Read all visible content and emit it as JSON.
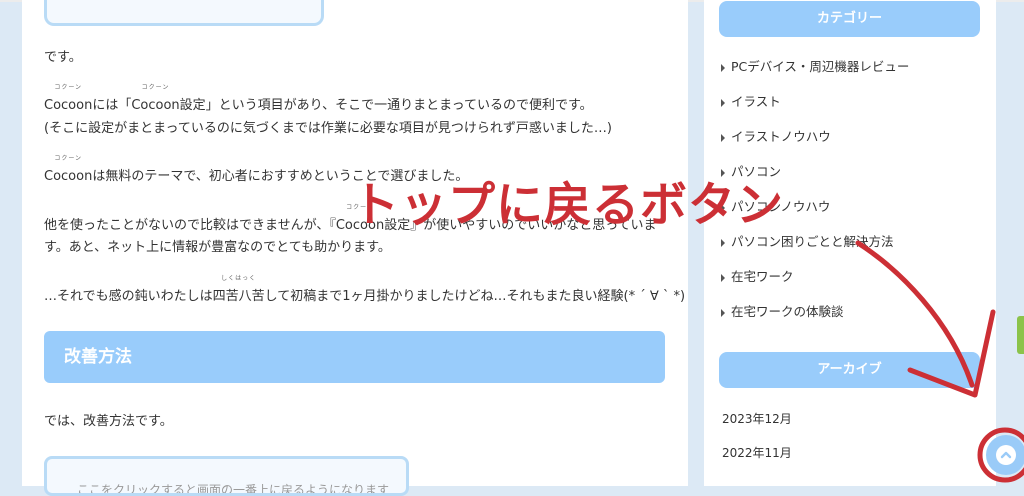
{
  "article": {
    "p1": "です。",
    "p2_ruby_text": "コクーン",
    "p2_word": "Cocoon",
    "p2_mid": "には「",
    "p2_ruby2_text": "コクーン",
    "p2_word2": "Cocoon",
    "p2_rest": "設定」という項目があり、そこで一通りまとまっているので便利です。",
    "p3": "(そこに設定がまとまっているのに気づくまでは作業に必要な項目が見つけられず戸惑いました…)",
    "p4_ruby_text": "コクーン",
    "p4_word": "Cocoon",
    "p4_rest": "は無料のテーマで、初心者におすすめということで選びました。",
    "p5_a": "他を使ったことがないので比較はできませんが、『",
    "p5_ruby_text": "コクーン",
    "p5_word": "Cocoon",
    "p5_b": "設定』が使いやすいのでいいかなと思っていま",
    "p6": "す。あと、ネット上に情報が豊富なのでとても助かります。",
    "p7_a": "…それでも感の鈍いわたしは",
    "p7_ruby_text": "しくはっく",
    "p7_word": "四苦八苦",
    "p7_b": "して初稿まで1ヶ月掛かりましたけどね…それもまた良い経験(* ´ ∀ ` *)",
    "h2": "改善方法",
    "p8": "では、改善方法です。",
    "box_text": "ここをクリックすると画面の一番上に戻るようになります"
  },
  "sidebar": {
    "categories_title": "カテゴリー",
    "categories": [
      "PCデバイス・周辺機器レビュー",
      "イラスト",
      "イラストノウハウ",
      "パソコン",
      "パソコンノウハウ",
      "パソコン困りごとと解決方法",
      "在宅ワーク",
      "在宅ワークの体験談"
    ],
    "archive_title": "アーカイブ",
    "archives": [
      "2023年12月",
      "2022年11月"
    ]
  },
  "annotation": {
    "text": "トップに戻るボタン",
    "color": "#cc2f35"
  },
  "icons": {
    "scroll_top": "chevron-up-icon"
  },
  "colors": {
    "accent": "#99ccfb",
    "background": "#dce9f5",
    "annotation_red": "#cc2f35"
  }
}
